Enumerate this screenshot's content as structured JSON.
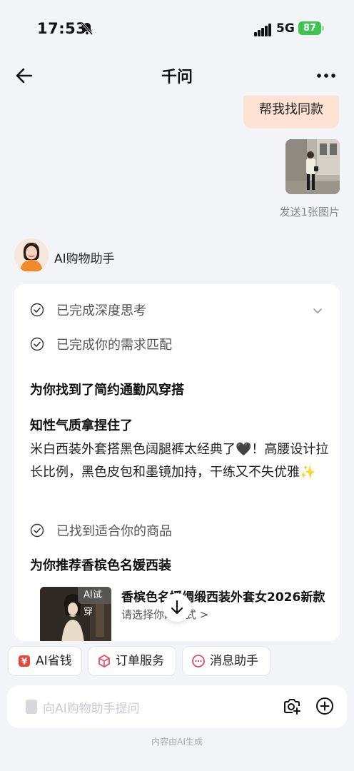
{
  "status_bar": {
    "time": "17:53",
    "network": "5G",
    "battery": "87"
  },
  "nav": {
    "title": "千问",
    "back_icon": "back-arrow-icon",
    "more_icon": "more-dots-icon"
  },
  "conversation": {
    "user_message": "帮我找同款",
    "sent_caption": "发送1张图片",
    "assistant_name": "AI购物助手"
  },
  "answer": {
    "steps": [
      {
        "label": "已完成深度思考"
      },
      {
        "label": "已完成你的需求匹配"
      }
    ],
    "heading_main": "为你找到了简约通勤风穿搭",
    "heading_sub": "知性气质拿捏住了",
    "body": "米白西装外套搭黑色阔腿裤太经典了🖤！高腰设计拉长比例，黑色皮包和墨镜加持，干练又不失优雅✨",
    "found_step": "已找到适合你的商品",
    "recommend_heading": "为你推荐香槟色名媛西装",
    "product": {
      "badge": "AI试穿",
      "title": "香槟色名媛绸缎西装外套女2026新款",
      "subtitle": "请选择你的款式 >"
    }
  },
  "quick_actions": [
    {
      "label": "AI省钱",
      "icon": "savings-icon",
      "color": "#e4483b"
    },
    {
      "label": "订单服务",
      "icon": "order-box-icon",
      "color": "#e94a62"
    },
    {
      "label": "消息助手",
      "icon": "message-icon",
      "color": "#e94a62"
    }
  ],
  "input": {
    "placeholder": "向AI购物助手提问",
    "camera_icon": "camera-add-icon",
    "plus_icon": "plus-circle-icon"
  },
  "footer": "内容由AI生成",
  "colors": {
    "accent": "#fde1d3",
    "battery": "#3fc452"
  }
}
